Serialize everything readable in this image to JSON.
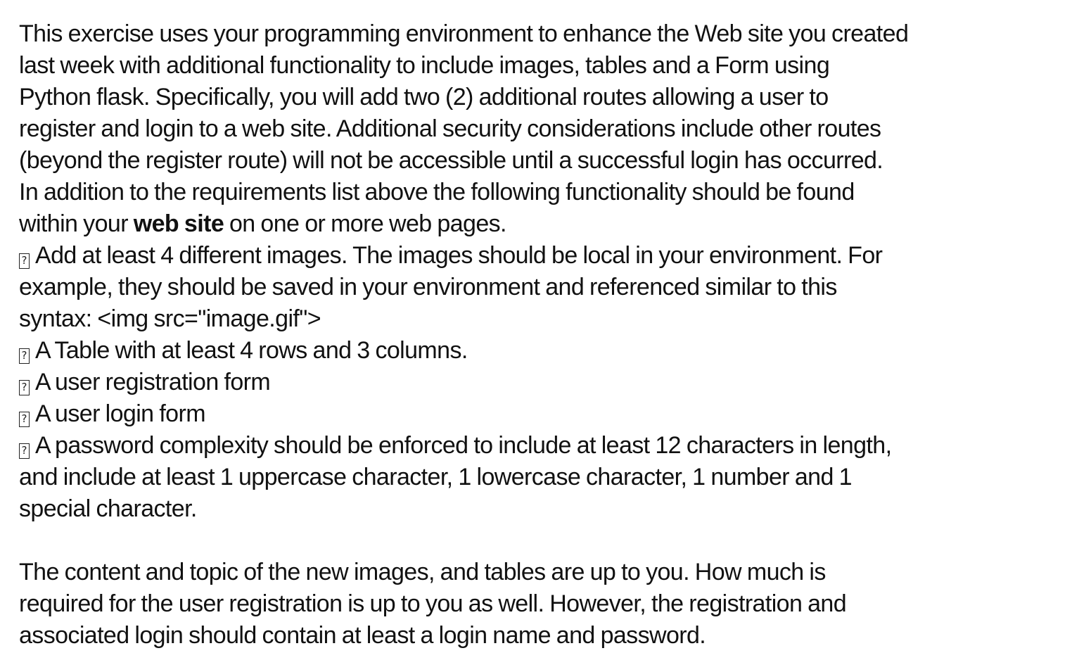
{
  "document": {
    "paragraph1": {
      "lines": [
        "This exercise uses your programming environment to enhance the Web site you created",
        "last week with additional functionality to include images, tables and a Form using",
        "Python flask. Specifically, you will add two (2) additional routes allowing a user to",
        "register and login to a web site. Additional security considerations include other routes",
        "(beyond the register route) will not be accessible until a successful login has occurred.",
        "In addition to the requirements list above the following functionality should be found"
      ],
      "last_line_prefix": "within your ",
      "last_line_bold": "web site",
      "last_line_suffix": " on one or more web pages."
    },
    "bullet_glyph": "?",
    "bullets": [
      {
        "lines": [
          "Add at least 4 different images. The images should be local in your environment. For",
          "example, they should be saved in your environment and referenced similar to this",
          "syntax: <img src=\"image.gif\">"
        ]
      },
      {
        "lines": [
          "A Table with at least 4 rows and 3 columns."
        ]
      },
      {
        "lines": [
          "A user registration form"
        ]
      },
      {
        "lines": [
          "A user login form"
        ]
      },
      {
        "lines": [
          "A password complexity should be enforced to include at least 12 characters in length,",
          "and include at least 1 uppercase character, 1 lowercase character, 1 number and 1",
          "special character."
        ]
      }
    ],
    "paragraph2": {
      "lines": [
        "The content and topic of the new images, and tables are up to you. How much is",
        "required for the user registration is up to you as well. However, the registration and",
        "associated login should contain at least a login name and password."
      ]
    }
  }
}
